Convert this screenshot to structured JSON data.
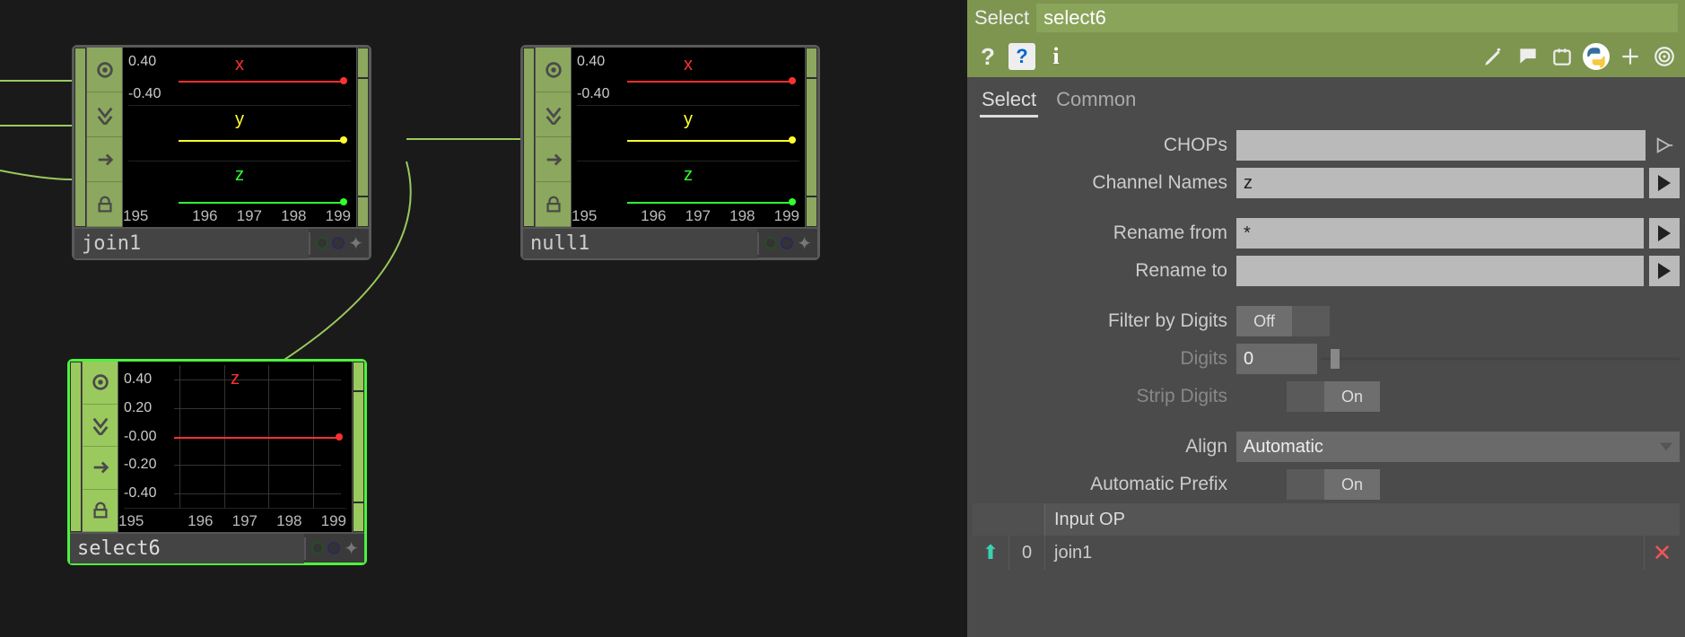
{
  "operator_type": "Select",
  "operator_name": "select6",
  "tabs": {
    "select": "Select",
    "common": "Common",
    "active": 0
  },
  "params": {
    "chops_label": "CHOPs",
    "chops_value": "",
    "channel_names_label": "Channel Names",
    "channel_names_value": "z",
    "rename_from_label": "Rename from",
    "rename_from_value": "*",
    "rename_to_label": "Rename to",
    "rename_to_value": "",
    "filter_digits_label": "Filter by Digits",
    "filter_digits_value": "Off",
    "digits_label": "Digits",
    "digits_value": "0",
    "strip_digits_label": "Strip Digits",
    "strip_digits_value": "On",
    "align_label": "Align",
    "align_value": "Automatic",
    "auto_prefix_label": "Automatic Prefix",
    "auto_prefix_value": "On",
    "input_op_label": "Input OP",
    "input_op_index": "0",
    "input_op_value": "join1"
  },
  "nodes": {
    "join1": {
      "name": "join1",
      "channels": [
        {
          "label": "x",
          "color": "#ff3030",
          "value_pos": 50
        },
        {
          "label": "y",
          "color": "#ffff30",
          "value_pos": 60
        },
        {
          "label": "z",
          "color": "#30ff30",
          "value_pos": 82
        }
      ],
      "xticks": [
        "195",
        "196",
        "197",
        "198",
        "199"
      ],
      "yticks": [
        "0.40",
        "-0.40"
      ]
    },
    "null1": {
      "name": "null1",
      "channels": [
        {
          "label": "x",
          "color": "#ff3030",
          "value_pos": 50
        },
        {
          "label": "y",
          "color": "#ffff30",
          "value_pos": 60
        },
        {
          "label": "z",
          "color": "#30ff30",
          "value_pos": 82
        }
      ],
      "xticks": [
        "195",
        "196",
        "197",
        "198",
        "199"
      ],
      "yticks": [
        "0.40",
        "-0.40"
      ]
    },
    "select6": {
      "name": "select6",
      "channel_label": "z",
      "channel_color": "#ff3030",
      "value_pos": 50,
      "xticks": [
        "195",
        "196",
        "197",
        "198",
        "199"
      ],
      "yticks": [
        "0.40",
        "0.20",
        "-0.00",
        "-0.20",
        "-0.40"
      ]
    }
  },
  "chart_data": [
    {
      "node": "join1",
      "type": "line",
      "channels": [
        "x",
        "y",
        "z"
      ],
      "x_range": [
        195,
        199
      ],
      "y_range": [
        -0.4,
        0.4
      ],
      "values": {
        "x": -0.2,
        "y": 0.0,
        "z": -0.3
      }
    },
    {
      "node": "null1",
      "type": "line",
      "channels": [
        "x",
        "y",
        "z"
      ],
      "x_range": [
        195,
        199
      ],
      "y_range": [
        -0.4,
        0.4
      ],
      "values": {
        "x": -0.2,
        "y": 0.0,
        "z": -0.3
      }
    },
    {
      "node": "select6",
      "type": "line",
      "channels": [
        "z"
      ],
      "x_range": [
        195,
        199
      ],
      "y_range": [
        -0.4,
        0.4
      ],
      "values": {
        "z": 0.0
      }
    }
  ]
}
